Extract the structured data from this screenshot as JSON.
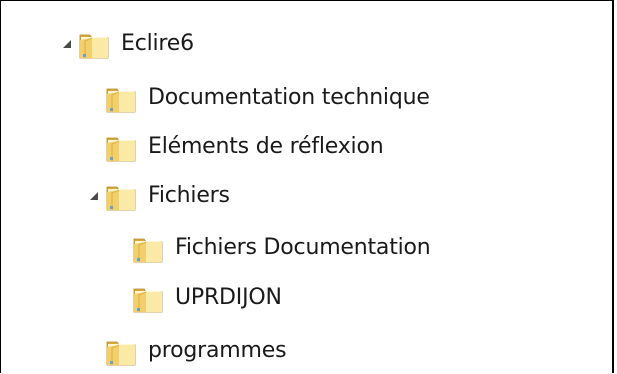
{
  "tree": {
    "items": [
      {
        "label": "Eclire6",
        "level": 0,
        "expanded": true,
        "has_children": true
      },
      {
        "label": "Documentation technique",
        "level": 1,
        "expanded": false,
        "has_children": false
      },
      {
        "label": "Eléments de réflexion",
        "level": 1,
        "expanded": false,
        "has_children": false
      },
      {
        "label": "Fichiers",
        "level": 1,
        "expanded": true,
        "has_children": true
      },
      {
        "label": "Fichiers Documentation",
        "level": 2,
        "expanded": false,
        "has_children": false
      },
      {
        "label": "UPRDIJON",
        "level": 2,
        "expanded": false,
        "has_children": false
      },
      {
        "label": "programmes",
        "level": 1,
        "expanded": false,
        "has_children": false
      }
    ],
    "icon": "folder-icon",
    "expander_icon": "expanded-triangle-icon",
    "colors": {
      "folder_light": "#fbe9a6",
      "folder_mid": "#f2cf6a",
      "folder_dark": "#d9a93a",
      "folder_edge": "#b8892a",
      "text": "#1a1a1a",
      "expander": "#4a4a4a"
    }
  }
}
